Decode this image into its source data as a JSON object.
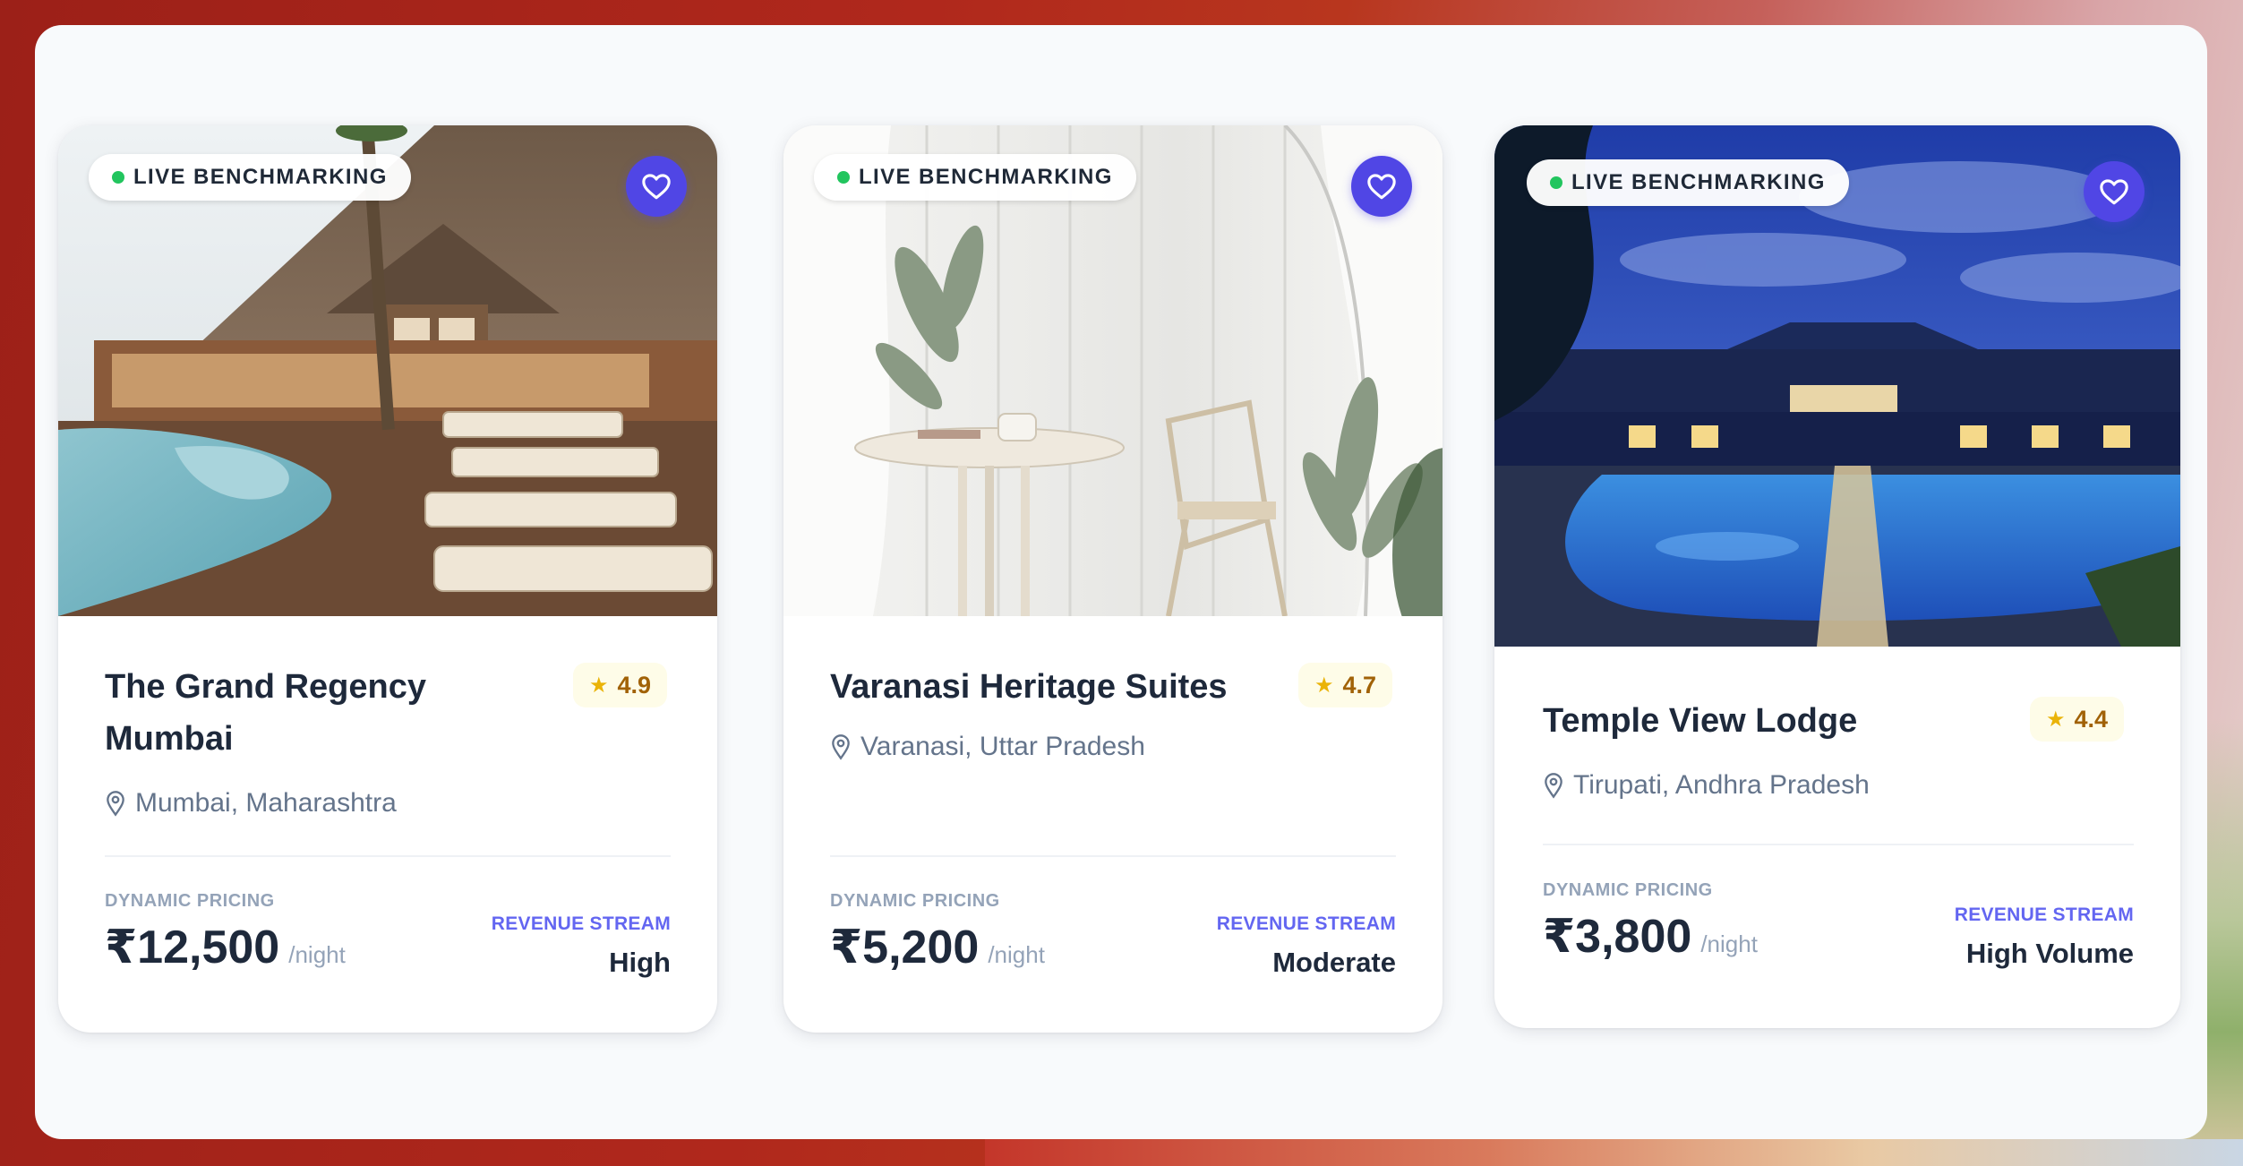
{
  "cards": [
    {
      "badge": "LIVE BENCHMARKING",
      "favorite_icon": "heart-icon",
      "title": "The Grand Regency Mumbai",
      "rating": "4.9",
      "location": "Mumbai, Maharashtra",
      "pricing_label": "DYNAMIC PRICING",
      "price": "₹12,500",
      "price_unit": "/night",
      "revenue_label": "REVENUE STREAM",
      "revenue_value": "High"
    },
    {
      "badge": "LIVE BENCHMARKING",
      "favorite_icon": "heart-icon",
      "title": "Varanasi Heritage Suites",
      "rating": "4.7",
      "location": "Varanasi, Uttar Pradesh",
      "pricing_label": "DYNAMIC PRICING",
      "price": "₹5,200",
      "price_unit": "/night",
      "revenue_label": "REVENUE STREAM",
      "revenue_value": "Moderate"
    },
    {
      "badge": "LIVE BENCHMARKING",
      "favorite_icon": "heart-icon",
      "title": "Temple View Lodge",
      "rating": "4.4",
      "location": "Tirupati, Andhra Pradesh",
      "pricing_label": "DYNAMIC PRICING",
      "price": "₹3,800",
      "price_unit": "/night",
      "revenue_label": "REVENUE STREAM",
      "revenue_value": "High Volume"
    }
  ],
  "colors": {
    "accent": "#5046e5",
    "live_dot": "#22c55e",
    "revenue_label": "#6366f1",
    "rating_star": "#eab308"
  }
}
